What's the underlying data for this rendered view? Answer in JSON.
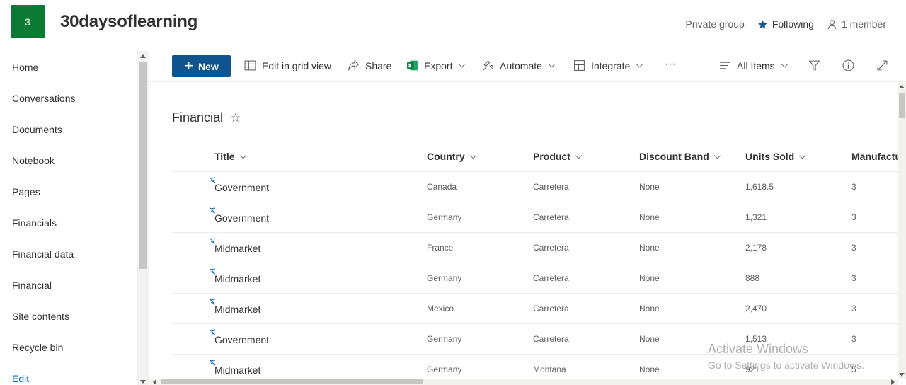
{
  "header": {
    "site_logo_text": "3",
    "site_title": "30daysoflearning",
    "privacy": "Private group",
    "following": "Following",
    "members": "1 member",
    "accent_color": "#0b7a35"
  },
  "nav": {
    "items": [
      "Home",
      "Conversations",
      "Documents",
      "Notebook",
      "Pages",
      "Financials",
      "Financial data",
      "Financial",
      "Site contents",
      "Recycle bin"
    ],
    "edit": "Edit"
  },
  "command_bar": {
    "new": "New",
    "edit_grid": "Edit in grid view",
    "share": "Share",
    "export": "Export",
    "automate": "Automate",
    "integrate": "Integrate",
    "more": "···",
    "view": "All Items"
  },
  "list": {
    "title": "Financial",
    "columns": [
      "Title",
      "Country",
      "Product",
      "Discount Band",
      "Units Sold",
      "Manufactu"
    ],
    "rows": [
      {
        "title": "Government",
        "country": "Canada",
        "product": "Carretera",
        "discount": "None",
        "units": "1,618.5",
        "mfg": "3"
      },
      {
        "title": "Government",
        "country": "Germany",
        "product": "Carretera",
        "discount": "None",
        "units": "1,321",
        "mfg": "3"
      },
      {
        "title": "Midmarket",
        "country": "France",
        "product": "Carretera",
        "discount": "None",
        "units": "2,178",
        "mfg": "3"
      },
      {
        "title": "Midmarket",
        "country": "Germany",
        "product": "Carretera",
        "discount": "None",
        "units": "888",
        "mfg": "3"
      },
      {
        "title": "Midmarket",
        "country": "Mexico",
        "product": "Carretera",
        "discount": "None",
        "units": "2,470",
        "mfg": "3"
      },
      {
        "title": "Government",
        "country": "Germany",
        "product": "Carretera",
        "discount": "None",
        "units": "1,513",
        "mfg": "3"
      },
      {
        "title": "Midmarket",
        "country": "Germany",
        "product": "Montana",
        "discount": "None",
        "units": "921",
        "mfg": "5"
      }
    ]
  },
  "watermark": {
    "line1": "Activate Windows",
    "line2": "Go to Settings to activate Windows."
  }
}
